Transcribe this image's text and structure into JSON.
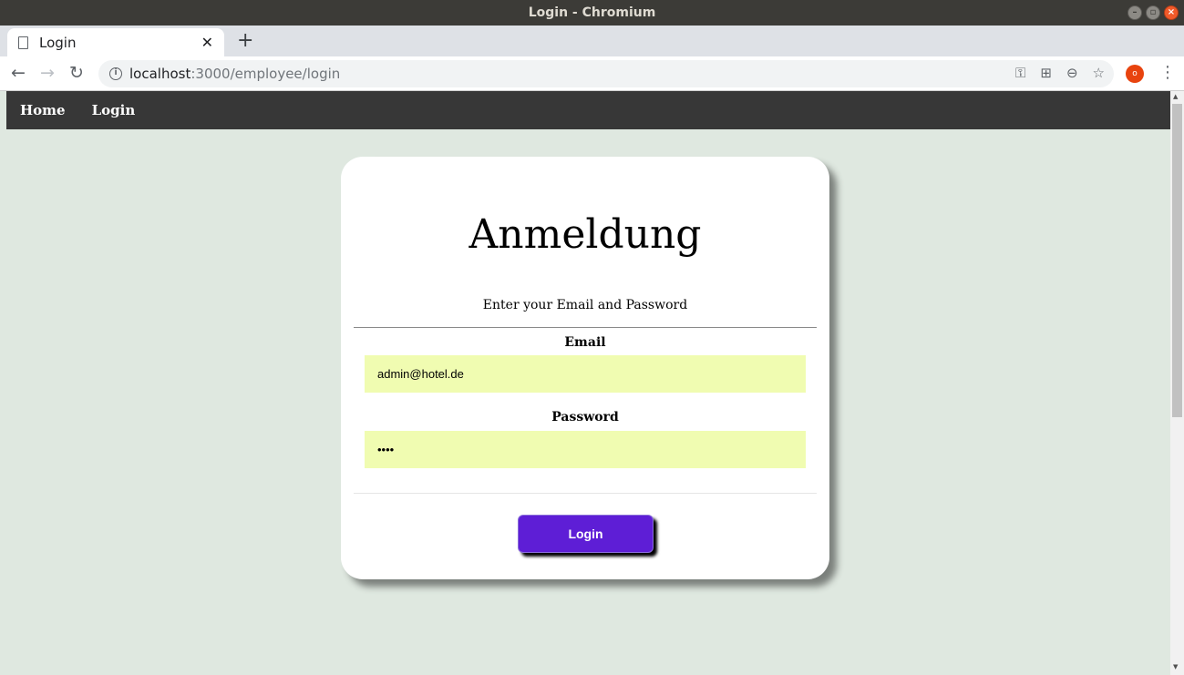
{
  "window": {
    "title": "Login - Chromium"
  },
  "browser": {
    "tab_title": "Login",
    "url_host": "localhost",
    "url_path": ":3000/employee/login",
    "profile_initial": "o"
  },
  "sitenav": {
    "items": [
      "Home",
      "Login"
    ]
  },
  "form": {
    "heading": "Anmeldung",
    "subtitle": "Enter your Email and Password",
    "email_label": "Email",
    "email_value": "admin@hotel.de",
    "password_label": "Password",
    "password_value": "••••",
    "submit_label": "Login"
  },
  "colors": {
    "input_bg": "#f0fcb1",
    "button_bg": "#5e1ed6",
    "nav_bg": "#373737",
    "page_bg": "#dfe8e0"
  }
}
